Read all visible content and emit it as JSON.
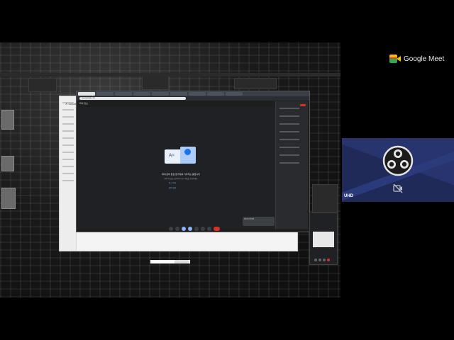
{
  "brand": {
    "name": "Google Meet"
  },
  "participant": {
    "name": "UHD",
    "camera_state": "camera-off"
  },
  "shared_screen": {
    "doc_window": {
      "header": "✕ Cloud",
      "footer_left": "",
      "footer_right": ""
    },
    "meet_window": {
      "url": "meet.google.com",
      "title": "회의 정보",
      "message": "회의 준비 완료 참가자를 기다리는 중입니다",
      "sub_message": "회의 링크를 공유하여 다른 사람을 초대하세요",
      "link_left": "링크 복사",
      "link_right": "참여 요청"
    },
    "toast": "회의 링크 공유됨"
  },
  "colors": {
    "accent_blue": "#1a73e8",
    "end_call_red": "#d93025",
    "tile_bg": "#1f2a59"
  },
  "icons": [
    "meet-logo-icon",
    "obs-logo-icon",
    "camera-off-icon"
  ]
}
